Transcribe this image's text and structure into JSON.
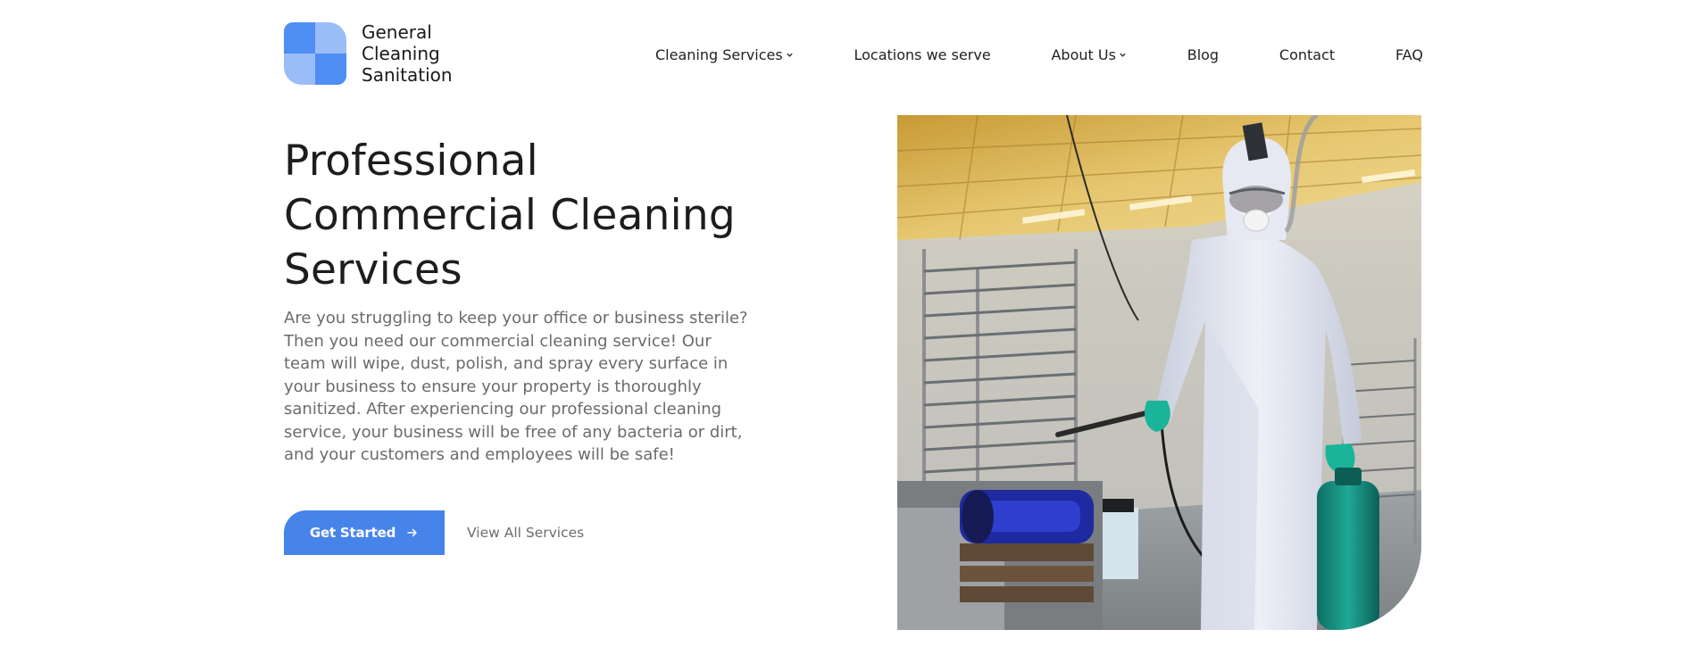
{
  "brand": {
    "name_lines": [
      "General",
      "Cleaning",
      "Sanitation"
    ],
    "logo_icon": "gcs-logo-mark-icon",
    "color": "#4784e9"
  },
  "nav": {
    "items": [
      {
        "label": "Cleaning Services",
        "has_dropdown": true
      },
      {
        "label": "Locations we serve",
        "has_dropdown": false
      },
      {
        "label": "About Us",
        "has_dropdown": true
      },
      {
        "label": "Blog",
        "has_dropdown": false
      },
      {
        "label": "Contact",
        "has_dropdown": false
      },
      {
        "label": "FAQ",
        "has_dropdown": false
      }
    ],
    "dropdown_icon": "chevron-down-icon"
  },
  "hero": {
    "title_lines": [
      "Professional",
      "Commercial Cleaning",
      "Services"
    ],
    "description": "Are you struggling to keep your office or business sterile? Then you need our commercial cleaning service! Our team will wipe, dust, polish, and spray every surface in your business to ensure your property is thoroughly sanitized. After experiencing our professional cleaning service, your business will be free of any bacteria or dirt, and your customers and employees will be safe!",
    "primary_button": {
      "label": "Get Started",
      "icon": "arrow-right-icon"
    },
    "secondary_link": {
      "label": "View All Services"
    },
    "image": {
      "subject": "worker-in-protective-suit-spraying-disinfectant-photo"
    }
  },
  "colors": {
    "accent": "#4784e9",
    "text_dark": "#1d1d1f",
    "text_muted": "#6b6b6b"
  }
}
